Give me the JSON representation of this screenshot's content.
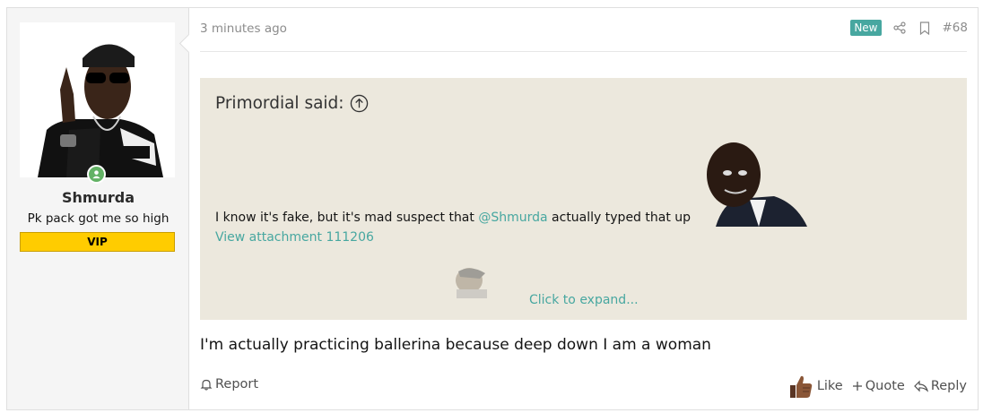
{
  "user": {
    "name": "Shmurda",
    "title": "Pk pack got me so high",
    "banner": "VIP",
    "online_color": "#63b265"
  },
  "post": {
    "time": "3 minutes ago",
    "badge": "New",
    "number": "#68",
    "message": "I'm actually practicing ballerina because deep down I am a woman"
  },
  "quote": {
    "author_said": "Primordial said:",
    "text_before": "I know it's fake, but it's mad suspect that ",
    "mention": "@Shmurda",
    "text_after": " actually typed that up",
    "attachment": "View attachment 111206",
    "expand": "Click to expand..."
  },
  "footer": {
    "report": "Report",
    "like": "Like",
    "quote": "Quote",
    "reply": "Reply"
  },
  "colors": {
    "accent": "#47a7a0",
    "quote_bg": "#ece8dd",
    "vip": "#ffcc00"
  },
  "icons": [
    "share-icon",
    "bookmark-icon",
    "arrow-up-circle-icon",
    "bell-icon",
    "plus-icon",
    "reply-icon",
    "thumbs-up-icon"
  ]
}
